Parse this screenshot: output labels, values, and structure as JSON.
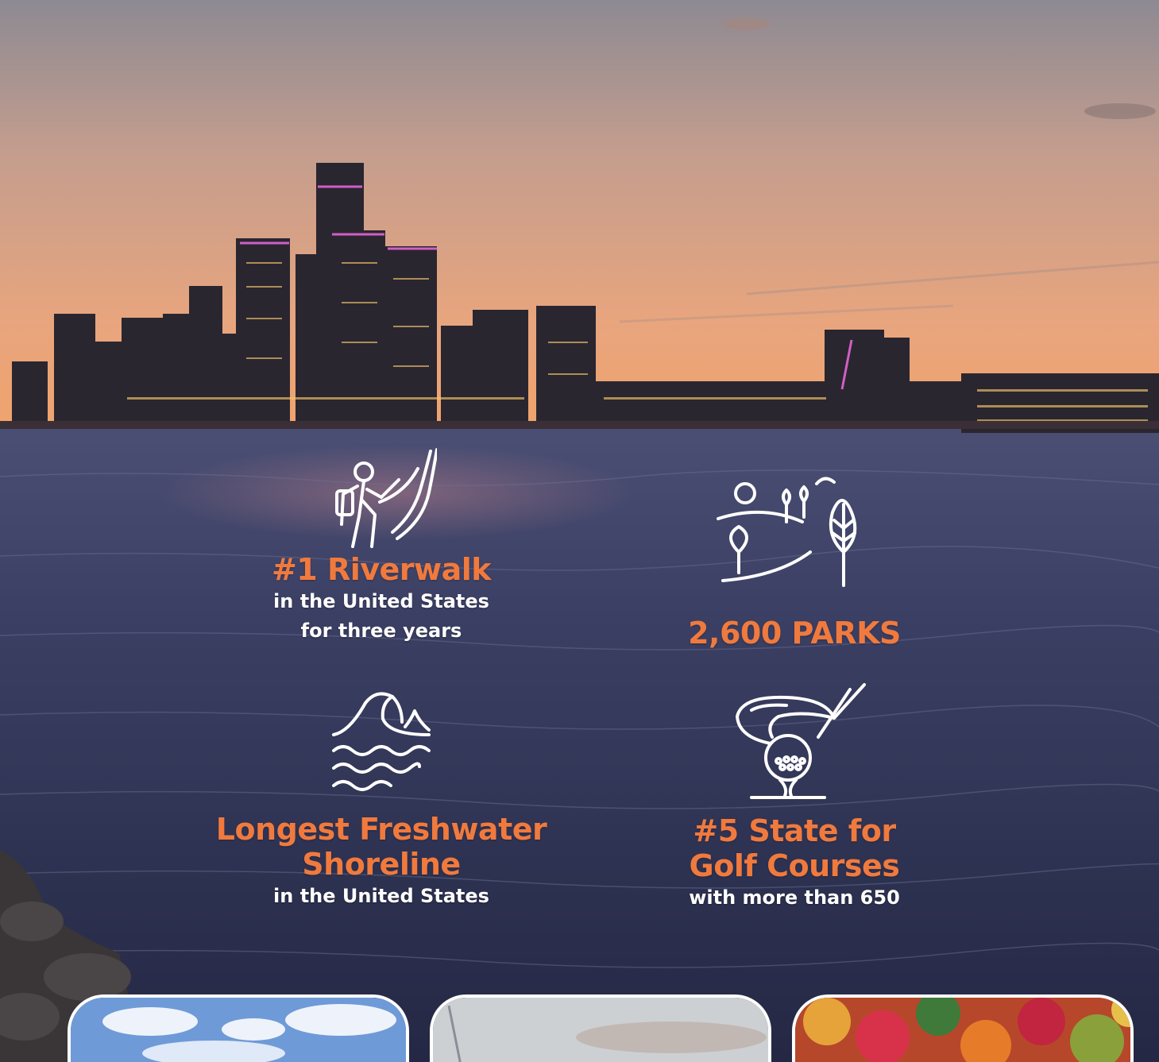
{
  "stats": [
    {
      "title": "#1 Riverwalk",
      "sub_lines": [
        "in the United States",
        "for three years"
      ],
      "icon": "hiker-icon"
    },
    {
      "title": "2,600 PARKS",
      "sub_lines": [],
      "icon": "park-trees-icon"
    },
    {
      "title_lines": [
        "Longest Freshwater",
        "Shoreline"
      ],
      "sub_lines": [
        "in the United States"
      ],
      "icon": "wave-icon"
    },
    {
      "title_lines": [
        "#5 State for",
        "Golf Courses"
      ],
      "sub_lines": [
        "with more than 650"
      ],
      "icon": "golf-ball-tee-icon"
    }
  ],
  "cards": [
    {
      "name": "sky-clouds-image"
    },
    {
      "name": "sailboat-image"
    },
    {
      "name": "autumn-trees-image"
    }
  ],
  "colors": {
    "accent": "#f07a3e",
    "text": "#ffffff"
  }
}
